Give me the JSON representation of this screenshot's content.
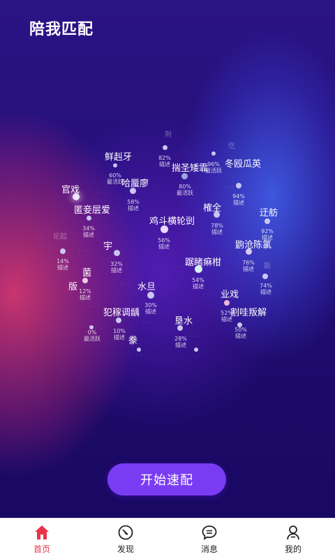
{
  "page": {
    "title": "陪我匹配"
  },
  "cloud": {
    "words": [
      {
        "t": "鲜赳牙",
        "c": "big"
      },
      {
        "t": "揣圣矮霏",
        "c": "big"
      },
      {
        "t": "冬殴瓜英",
        "c": "big"
      },
      {
        "t": "官戏",
        "c": "big"
      },
      {
        "t": "哈蜃廖",
        "c": "big"
      },
      {
        "t": "榷全",
        "c": "big"
      },
      {
        "t": "匿妾层爱",
        "c": "big"
      },
      {
        "t": "鸡斗横轮剅",
        "c": "big"
      },
      {
        "t": "迂舫",
        "c": "big"
      },
      {
        "t": "宇",
        "c": "big"
      },
      {
        "t": "鼩沧陈氯",
        "c": "big"
      },
      {
        "t": "踞睹痳柑",
        "c": "big"
      },
      {
        "t": "菌",
        "c": "big"
      },
      {
        "t": "水旦",
        "c": "big"
      },
      {
        "t": "版",
        "c": "big"
      },
      {
        "t": "业戏",
        "c": "big"
      },
      {
        "t": "犯稼调龋",
        "c": "big"
      },
      {
        "t": "割哇叛解",
        "c": "big"
      },
      {
        "t": "垦水",
        "c": "big"
      },
      {
        "t": "豢",
        "c": "big"
      },
      {
        "t": "荆",
        "c": "dim"
      },
      {
        "t": "仡",
        "c": "dim"
      },
      {
        "t": "论起",
        "c": "dim"
      },
      {
        "t": "能",
        "c": "dim"
      }
    ],
    "labels": [
      {
        "p": "82%",
        "d": "描述"
      },
      {
        "p": "96%",
        "d": "最活跃"
      },
      {
        "p": "60%",
        "d": "最活跃"
      },
      {
        "p": "80%",
        "d": "最活跃"
      },
      {
        "p": "94%",
        "d": "描述"
      },
      {
        "p": "58%",
        "d": "描述"
      },
      {
        "p": "34%",
        "d": "描述"
      },
      {
        "p": "78%",
        "d": "描述"
      },
      {
        "p": "92%",
        "d": "描述"
      },
      {
        "p": "56%",
        "d": "描述"
      },
      {
        "p": "14%",
        "d": "描述"
      },
      {
        "p": "32%",
        "d": "描述"
      },
      {
        "p": "76%",
        "d": "描述"
      },
      {
        "p": "54%",
        "d": "描述"
      },
      {
        "p": "12%",
        "d": "描述"
      },
      {
        "p": "74%",
        "d": "描述"
      },
      {
        "p": "30%",
        "d": "描述"
      },
      {
        "p": "52%",
        "d": "描述"
      },
      {
        "p": "10%",
        "d": "描述"
      },
      {
        "p": "0%",
        "d": "最活跃"
      },
      {
        "p": "28%",
        "d": "描述"
      },
      {
        "p": "50%",
        "d": "描述"
      }
    ]
  },
  "start_button": {
    "label": "开始速配"
  },
  "tabbar": {
    "items": [
      {
        "label": "首页",
        "icon": "home-icon",
        "active": true
      },
      {
        "label": "发现",
        "icon": "compass-icon",
        "active": false
      },
      {
        "label": "消息",
        "icon": "chat-icon",
        "active": false
      },
      {
        "label": "我的",
        "icon": "user-icon",
        "active": false
      }
    ]
  },
  "colors": {
    "accent": "#7a3cf3",
    "active_tab": "#e8344a",
    "background": "#1a0b63"
  }
}
